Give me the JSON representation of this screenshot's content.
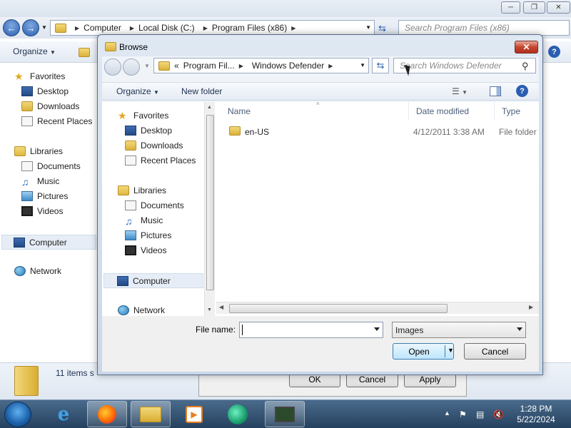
{
  "explorer": {
    "address_crumbs": [
      "Computer",
      "Local Disk (C:)",
      "Program Files (x86)"
    ],
    "search_placeholder": "Search Program Files (x86)",
    "organize_label": "Organize",
    "nav": {
      "favorites": "Favorites",
      "desktop": "Desktop",
      "downloads": "Downloads",
      "recent": "Recent Places",
      "libraries": "Libraries",
      "documents": "Documents",
      "music": "Music",
      "pictures": "Pictures",
      "videos": "Videos",
      "computer": "Computer",
      "network": "Network"
    },
    "status_text": "11 items s",
    "props_buttons": {
      "ok": "OK",
      "cancel": "Cancel",
      "apply": "Apply"
    }
  },
  "dialog": {
    "title": "Browse",
    "crumb_prefix": "«",
    "address_crumbs": [
      "Program Fil...",
      "Windows Defender"
    ],
    "search_placeholder": "Search Windows Defender",
    "organize_label": "Organize",
    "new_folder_label": "New folder",
    "nav": {
      "favorites": "Favorites",
      "desktop": "Desktop",
      "downloads": "Downloads",
      "recent": "Recent Places",
      "libraries": "Libraries",
      "documents": "Documents",
      "music": "Music",
      "pictures": "Pictures",
      "videos": "Videos",
      "computer": "Computer",
      "network": "Network"
    },
    "columns": {
      "name": "Name",
      "date": "Date modified",
      "type": "Type"
    },
    "rows": [
      {
        "name": "en-US",
        "date": "4/12/2011 3:38 AM",
        "type": "File folder"
      }
    ],
    "filename_label": "File name:",
    "filename_value": "",
    "filter_value": "Images",
    "open_label": "Open",
    "cancel_label": "Cancel"
  },
  "taskbar": {
    "time": "1:28 PM",
    "date": "5/22/2024"
  }
}
